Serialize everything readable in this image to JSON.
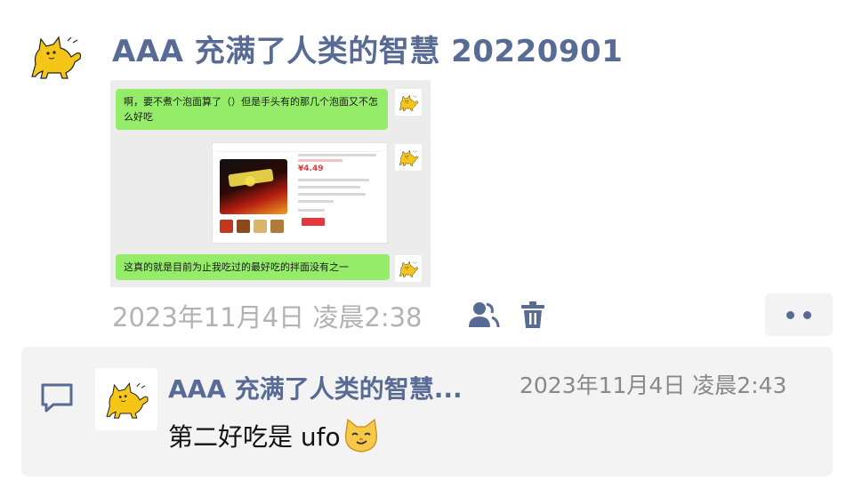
{
  "post": {
    "username": "AAA 充满了人类的智慧 20220901",
    "image": {
      "message_top": "啊，要不煮个泡面算了（）但是手头有的那几个泡面又不怎么好吃",
      "message_bottom": "这真的就是目前为止我吃过的最好吃的拌面没有之一",
      "product_price": "¥4.49"
    },
    "timestamp": "2023年11月4日 凌晨2:38",
    "icons": [
      "person-icon",
      "trash-icon",
      "more-icon"
    ]
  },
  "comment": {
    "author": "AAA 充满了人类的智慧...",
    "timestamp": "2023年11月4日 凌晨2:43",
    "text": "第二好吃是 ufo",
    "emoji": "smirk-cat-emoji"
  },
  "colors": {
    "link_blue": "#576b95",
    "bubble_green": "#95ec69",
    "meta_gray": "#b2b2b2",
    "panel_bg": "#f3f3f3",
    "cat_yellow": "#f5c518"
  }
}
